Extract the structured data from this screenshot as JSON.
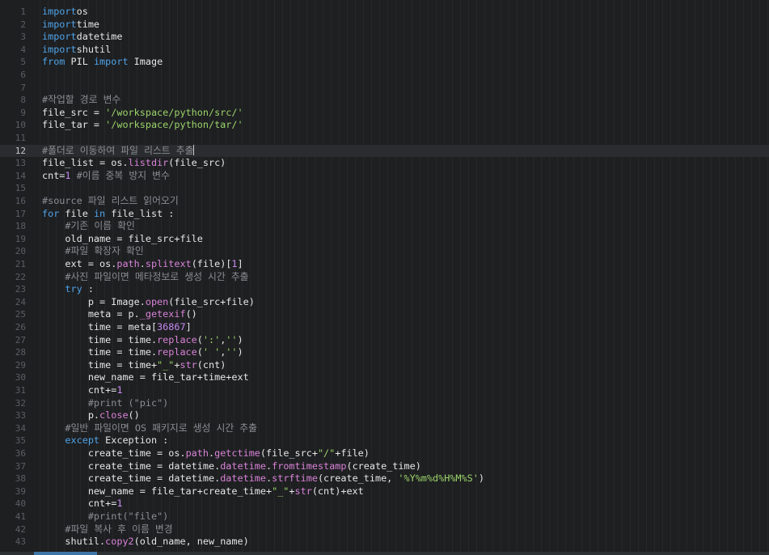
{
  "editor": {
    "current_line": 12,
    "lines": [
      {
        "n": "1",
        "t": [
          [
            "kw",
            "import"
          ],
          [
            "",
            "os"
          ]
        ]
      },
      {
        "n": "2",
        "t": [
          [
            "kw",
            "import"
          ],
          [
            "",
            "time"
          ]
        ]
      },
      {
        "n": "3",
        "t": [
          [
            "kw",
            "import"
          ],
          [
            "",
            "datetime"
          ]
        ]
      },
      {
        "n": "4",
        "t": [
          [
            "kw",
            "import"
          ],
          [
            "",
            "shutil"
          ]
        ]
      },
      {
        "n": "5",
        "t": [
          [
            "kw",
            "from"
          ],
          [
            "",
            " PIL "
          ],
          [
            "kw",
            "import"
          ],
          [
            "",
            " Image"
          ]
        ]
      },
      {
        "n": "6",
        "t": []
      },
      {
        "n": "7",
        "t": []
      },
      {
        "n": "8",
        "t": [
          [
            "cm",
            "#작업할 경로 변수"
          ]
        ]
      },
      {
        "n": "9",
        "t": [
          [
            "",
            "file_src = "
          ],
          [
            "str",
            "'/workspace/python/src/'"
          ]
        ]
      },
      {
        "n": "10",
        "t": [
          [
            "",
            "file_tar = "
          ],
          [
            "str",
            "'/workspace/python/tar/'"
          ]
        ]
      },
      {
        "n": "11",
        "t": []
      },
      {
        "n": "12",
        "t": [
          [
            "cm",
            "#폴더로 이동하여 파일 리스트 추출"
          ]
        ],
        "current": true
      },
      {
        "n": "13",
        "t": [
          [
            "",
            "file_list = os."
          ],
          [
            "fn",
            "listdir"
          ],
          [
            "",
            "(file_src)"
          ]
        ]
      },
      {
        "n": "14",
        "t": [
          [
            "",
            "cnt="
          ],
          [
            "num",
            "1"
          ],
          [
            "",
            " "
          ],
          [
            "cm",
            "#이름 중복 방지 변수"
          ]
        ]
      },
      {
        "n": "15",
        "t": []
      },
      {
        "n": "16",
        "t": [
          [
            "cm",
            "#source 파일 리스트 읽어오기"
          ]
        ]
      },
      {
        "n": "17",
        "t": [
          [
            "kw",
            "for"
          ],
          [
            "",
            " file "
          ],
          [
            "kw",
            "in"
          ],
          [
            "",
            " file_list :"
          ]
        ]
      },
      {
        "n": "18",
        "t": [
          [
            "",
            "    "
          ],
          [
            "cm",
            "#기존 이름 확인"
          ]
        ]
      },
      {
        "n": "19",
        "t": [
          [
            "",
            "    old_name = file_src+file"
          ]
        ]
      },
      {
        "n": "20",
        "t": [
          [
            "",
            "    "
          ],
          [
            "cm",
            "#파일 확장자 확인"
          ]
        ]
      },
      {
        "n": "21",
        "t": [
          [
            "",
            "    ext = os."
          ],
          [
            "fn",
            "path"
          ],
          [
            "",
            "."
          ],
          [
            "fn",
            "splitext"
          ],
          [
            "",
            "(file)["
          ],
          [
            "num",
            "1"
          ],
          [
            "",
            "]"
          ]
        ]
      },
      {
        "n": "22",
        "t": [
          [
            "",
            "    "
          ],
          [
            "cm",
            "#사진 파일이면 메타정보로 생성 시간 추출"
          ]
        ]
      },
      {
        "n": "23",
        "t": [
          [
            "",
            "    "
          ],
          [
            "kw",
            "try"
          ],
          [
            "",
            " :"
          ]
        ]
      },
      {
        "n": "24",
        "t": [
          [
            "",
            "        p = Image."
          ],
          [
            "fn",
            "open"
          ],
          [
            "",
            "(file_src+file)"
          ]
        ]
      },
      {
        "n": "25",
        "t": [
          [
            "",
            "        meta = p."
          ],
          [
            "fn",
            "_getexif"
          ],
          [
            "",
            "()"
          ]
        ]
      },
      {
        "n": "26",
        "t": [
          [
            "",
            "        time = meta["
          ],
          [
            "num",
            "36867"
          ],
          [
            "",
            "]"
          ]
        ]
      },
      {
        "n": "27",
        "t": [
          [
            "",
            "        time = time."
          ],
          [
            "fn",
            "replace"
          ],
          [
            "",
            "("
          ],
          [
            "str",
            "':'"
          ],
          [
            "",
            ","
          ],
          [
            "str",
            "''"
          ],
          [
            "",
            ")"
          ]
        ]
      },
      {
        "n": "28",
        "t": [
          [
            "",
            "        time = time."
          ],
          [
            "fn",
            "replace"
          ],
          [
            "",
            "("
          ],
          [
            "str",
            "' '"
          ],
          [
            "",
            ","
          ],
          [
            "str",
            "''"
          ],
          [
            "",
            ")"
          ]
        ]
      },
      {
        "n": "29",
        "t": [
          [
            "",
            "        time = time+"
          ],
          [
            "str",
            "\"_\""
          ],
          [
            "",
            "+"
          ],
          [
            "fn",
            "str"
          ],
          [
            "",
            "(cnt)"
          ]
        ]
      },
      {
        "n": "30",
        "t": [
          [
            "",
            "        new_name = file_tar+time+ext"
          ]
        ]
      },
      {
        "n": "31",
        "t": [
          [
            "",
            "        cnt+="
          ],
          [
            "num",
            "1"
          ]
        ]
      },
      {
        "n": "32",
        "t": [
          [
            "",
            "        "
          ],
          [
            "cm",
            "#print (\"pic\")"
          ]
        ]
      },
      {
        "n": "33",
        "t": [
          [
            "",
            "        p."
          ],
          [
            "fn",
            "close"
          ],
          [
            "",
            "()"
          ]
        ]
      },
      {
        "n": "34",
        "t": [
          [
            "",
            "    "
          ],
          [
            "cm",
            "#일반 파일이면 OS 패키지로 생성 시간 추출"
          ]
        ]
      },
      {
        "n": "35",
        "t": [
          [
            "",
            "    "
          ],
          [
            "kw",
            "except"
          ],
          [
            "",
            " Exception :"
          ]
        ]
      },
      {
        "n": "36",
        "t": [
          [
            "",
            "        create_time = os."
          ],
          [
            "fn",
            "path"
          ],
          [
            "",
            "."
          ],
          [
            "fn",
            "getctime"
          ],
          [
            "",
            "(file_src+"
          ],
          [
            "str",
            "\"/\""
          ],
          [
            "",
            "+file)"
          ]
        ]
      },
      {
        "n": "37",
        "t": [
          [
            "",
            "        create_time = datetime."
          ],
          [
            "fn",
            "datetime"
          ],
          [
            "",
            "."
          ],
          [
            "fn",
            "fromtimestamp"
          ],
          [
            "",
            "(create_time)"
          ]
        ]
      },
      {
        "n": "38",
        "t": [
          [
            "",
            "        create_time = datetime."
          ],
          [
            "fn",
            "datetime"
          ],
          [
            "",
            "."
          ],
          [
            "fn",
            "strftime"
          ],
          [
            "",
            "(create_time, "
          ],
          [
            "str",
            "'%Y%m%d%H%M%S'"
          ],
          [
            "",
            ")"
          ]
        ]
      },
      {
        "n": "39",
        "t": [
          [
            "",
            "        new_name = file_tar+create_time+"
          ],
          [
            "str",
            "\"_\""
          ],
          [
            "",
            "+"
          ],
          [
            "fn",
            "str"
          ],
          [
            "",
            "(cnt)+ext"
          ]
        ]
      },
      {
        "n": "40",
        "t": [
          [
            "",
            "        cnt+="
          ],
          [
            "num",
            "1"
          ]
        ]
      },
      {
        "n": "41",
        "t": [
          [
            "",
            "        "
          ],
          [
            "cm",
            "#print(\"file\")"
          ]
        ]
      },
      {
        "n": "42",
        "t": [
          [
            "",
            "    "
          ],
          [
            "cm",
            "#파일 복사 후 이름 변경"
          ]
        ]
      },
      {
        "n": "43",
        "t": [
          [
            "",
            "    shutil."
          ],
          [
            "fn",
            "copy2"
          ],
          [
            "",
            "(old_name, new_name)"
          ]
        ]
      }
    ]
  },
  "colors": {
    "background": "#1e1f21",
    "keyword": "#4ea3e8",
    "function": "#d883d8",
    "string": "#9bd46a",
    "comment": "#8a8e93",
    "number": "#c58af2",
    "scroll_thumb": "#3e76a8"
  }
}
